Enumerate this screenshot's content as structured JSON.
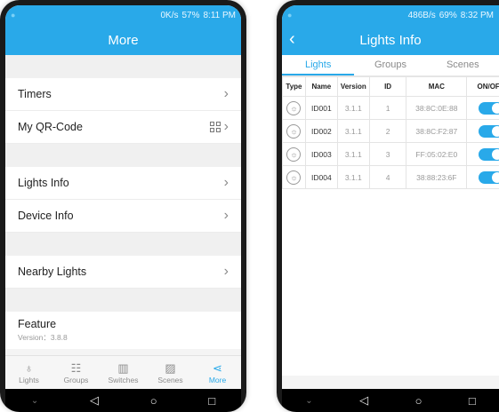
{
  "left": {
    "status": {
      "speed": "0K/s",
      "battery": "57%",
      "time": "8:11 PM"
    },
    "title": "More",
    "rows": {
      "timers": "Timers",
      "qr": "My QR-Code",
      "lights_info": "Lights Info",
      "device_info": "Device Info",
      "nearby": "Nearby Lights"
    },
    "feature": {
      "title": "Feature",
      "version": "Version：3.8.8"
    },
    "tabs": [
      {
        "label": "Lights",
        "icon": "bulb-icon"
      },
      {
        "label": "Groups",
        "icon": "groups-icon"
      },
      {
        "label": "Switches",
        "icon": "switch-icon"
      },
      {
        "label": "Scenes",
        "icon": "scene-icon"
      },
      {
        "label": "More",
        "icon": "share-icon"
      }
    ]
  },
  "right": {
    "status": {
      "speed": "486B/s",
      "battery": "69%",
      "time": "8:32 PM"
    },
    "title": "Lights Info",
    "subtabs": [
      "Lights",
      "Groups",
      "Scenes"
    ],
    "columns": [
      "Type",
      "Name",
      "Version",
      "ID",
      "MAC",
      "ON/OFF"
    ],
    "lights": [
      {
        "name": "ID001",
        "version": "3.1.1",
        "id": "1",
        "mac": "38:8C:0E:88",
        "on": true
      },
      {
        "name": "ID002",
        "version": "3.1.1",
        "id": "2",
        "mac": "38:8C:F2:87",
        "on": true
      },
      {
        "name": "ID003",
        "version": "3.1.1",
        "id": "3",
        "mac": "FF:05:02:E0",
        "on": true
      },
      {
        "name": "ID004",
        "version": "3.1.1",
        "id": "4",
        "mac": "38:88:23:6F",
        "on": true
      }
    ]
  },
  "colors": {
    "accent": "#29a9e9"
  }
}
